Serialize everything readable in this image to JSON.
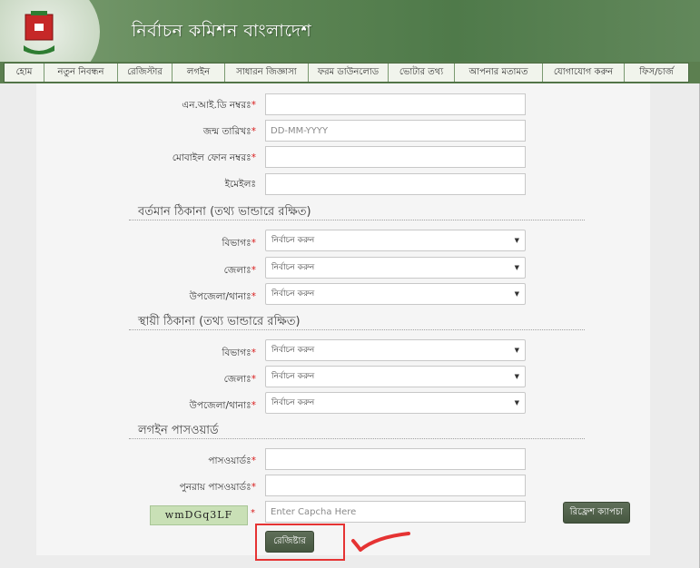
{
  "header": {
    "title": "নির্বাচন কমিশন বাংলাদেশ",
    "logo_icon": "ballot-box-logo-icon"
  },
  "nav": {
    "items": [
      "হোম",
      "নতুন নিবন্ধন",
      "রেজিস্টার",
      "লগইন",
      "সাধারন জিজ্ঞাসা",
      "ফরম ডাউনলোড",
      "ভোটার তথ্য",
      "আপনার মতামত",
      "যোগাযোগ করুন",
      "ফিস/চার্জ"
    ]
  },
  "form": {
    "nid_label": "এন.আই.ডি নম্বরঃ",
    "dob_label": "জন্ম তারিখঃ",
    "dob_placeholder": "DD-MM-YYYY",
    "mobile_label": "মোবাইল ফোন নম্বরঃ",
    "email_label": "ইমেইলঃ",
    "required_mark": "*"
  },
  "present_address": {
    "title": "বর্তমান ঠিকানা (তথ্য ভান্ডারে রক্ষিত)",
    "division_label": "বিভাগঃ",
    "district_label": "জেলাঃ",
    "upazila_label": "উপজেলা/থানাঃ",
    "select_placeholder": "নির্বাচন করুন"
  },
  "permanent_address": {
    "title": "স্থায়ী ঠিকানা (তথ্য ভান্ডারে রক্ষিত)",
    "division_label": "বিভাগঃ",
    "district_label": "জেলাঃ",
    "upazila_label": "উপজেলা/থানাঃ",
    "select_placeholder": "নির্বাচন করুন"
  },
  "login_password": {
    "title": "লগইন পাসওয়ার্ড",
    "password_label": "পাসওয়ার্ডঃ",
    "confirm_label": "পুনরায় পাসওয়ার্ডঃ"
  },
  "captcha": {
    "text": "wmDGq3LF",
    "input_placeholder": "Enter Capcha Here",
    "refresh_label": "রিফ্রেশ ক্যাপচা"
  },
  "actions": {
    "register_label": "রেজিষ্টার"
  },
  "colors": {
    "header_green": "#5e8655",
    "button_dark": "#465740",
    "required_red": "#d81b1b",
    "annotation_red": "#e53333"
  }
}
